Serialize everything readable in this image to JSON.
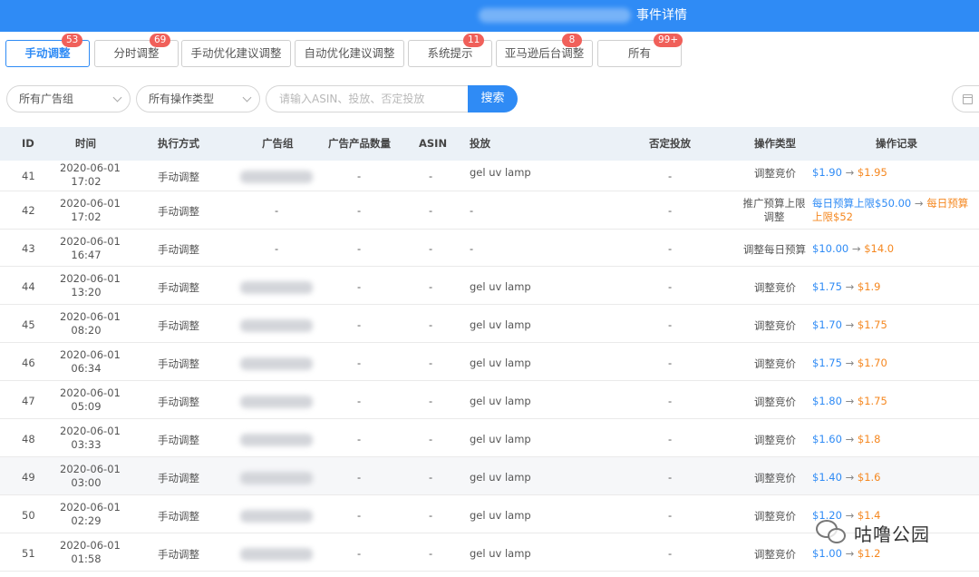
{
  "header": {
    "title": "事件详情"
  },
  "tabs": [
    {
      "label": "手动调整",
      "badge": "53"
    },
    {
      "label": "分时调整",
      "badge": "69"
    },
    {
      "label": "手动优化建议调整",
      "badge": ""
    },
    {
      "label": "自动优化建议调整",
      "badge": ""
    },
    {
      "label": "系统提示",
      "badge": "11"
    },
    {
      "label": "亚马逊后台调整",
      "badge": "8"
    },
    {
      "label": "所有",
      "badge": "99+"
    }
  ],
  "filters": {
    "ad_group_select": "所有广告组",
    "op_type_select": "所有操作类型",
    "search_placeholder": "请输入ASIN、投放、否定投放",
    "search_button": "搜索"
  },
  "columns": {
    "id": "ID",
    "time": "时间",
    "method": "执行方式",
    "ad_group": "广告组",
    "product_count": "广告产品数量",
    "asin": "ASIN",
    "targeting": "投放",
    "negative": "否定投放",
    "op_type": "操作类型",
    "op_record": "操作记录"
  },
  "rows": [
    {
      "id": "41",
      "date": "2020-06-01",
      "time": "17:02",
      "method": "手动调整",
      "ad_group": "",
      "product_count": "-",
      "asin": "-",
      "targeting": "gel uv lamp",
      "negative": "-",
      "op_type": "调整竞价",
      "from": "$1.90",
      "arrow": "→",
      "to": "$1.95"
    },
    {
      "id": "42",
      "date": "2020-06-01",
      "time": "17:02",
      "method": "手动调整",
      "ad_group": "-",
      "product_count": "-",
      "asin": "-",
      "targeting": "-",
      "negative": "-",
      "op_type": "推广预算上限调整",
      "from": "每日预算上限$50.00",
      "arrow": "→",
      "to": "每日预算上限$52"
    },
    {
      "id": "43",
      "date": "2020-06-01",
      "time": "16:47",
      "method": "手动调整",
      "ad_group": "-",
      "product_count": "-",
      "asin": "-",
      "targeting": "-",
      "negative": "-",
      "op_type": "调整每日预算",
      "from": "$10.00",
      "arrow": "→",
      "to": "$14.0"
    },
    {
      "id": "44",
      "date": "2020-06-01",
      "time": "13:20",
      "method": "手动调整",
      "ad_group": "",
      "product_count": "-",
      "asin": "-",
      "targeting": "gel uv lamp",
      "negative": "-",
      "op_type": "调整竞价",
      "from": "$1.75",
      "arrow": "→",
      "to": "$1.9"
    },
    {
      "id": "45",
      "date": "2020-06-01",
      "time": "08:20",
      "method": "手动调整",
      "ad_group": "",
      "product_count": "-",
      "asin": "-",
      "targeting": "gel uv lamp",
      "negative": "-",
      "op_type": "调整竞价",
      "from": "$1.70",
      "arrow": "→",
      "to": "$1.75"
    },
    {
      "id": "46",
      "date": "2020-06-01",
      "time": "06:34",
      "method": "手动调整",
      "ad_group": "",
      "product_count": "-",
      "asin": "-",
      "targeting": "gel uv lamp",
      "negative": "-",
      "op_type": "调整竞价",
      "from": "$1.75",
      "arrow": "→",
      "to": "$1.70"
    },
    {
      "id": "47",
      "date": "2020-06-01",
      "time": "05:09",
      "method": "手动调整",
      "ad_group": "",
      "product_count": "-",
      "asin": "-",
      "targeting": "gel uv lamp",
      "negative": "-",
      "op_type": "调整竞价",
      "from": "$1.80",
      "arrow": "→",
      "to": "$1.75"
    },
    {
      "id": "48",
      "date": "2020-06-01",
      "time": "03:33",
      "method": "手动调整",
      "ad_group": "",
      "product_count": "-",
      "asin": "-",
      "targeting": "gel uv lamp",
      "negative": "-",
      "op_type": "调整竞价",
      "from": "$1.60",
      "arrow": "→",
      "to": "$1.8"
    },
    {
      "id": "49",
      "date": "2020-06-01",
      "time": "03:00",
      "method": "手动调整",
      "ad_group": "",
      "product_count": "-",
      "asin": "-",
      "targeting": "gel uv lamp",
      "negative": "-",
      "op_type": "调整竞价",
      "from": "$1.40",
      "arrow": "→",
      "to": "$1.6"
    },
    {
      "id": "50",
      "date": "2020-06-01",
      "time": "02:29",
      "method": "手动调整",
      "ad_group": "",
      "product_count": "-",
      "asin": "-",
      "targeting": "gel uv lamp",
      "negative": "-",
      "op_type": "调整竞价",
      "from": "$1.20",
      "arrow": "→",
      "to": "$1.4"
    },
    {
      "id": "51",
      "date": "2020-06-01",
      "time": "01:58",
      "method": "手动调整",
      "ad_group": "",
      "product_count": "-",
      "asin": "-",
      "targeting": "gel uv lamp",
      "negative": "-",
      "op_type": "调整竞价",
      "from": "$1.00",
      "arrow": "→",
      "to": "$1.2"
    }
  ],
  "watermark": {
    "text": "咕噜公园"
  },
  "colors": {
    "accent": "#2f8bf5",
    "badge": "#f0605a",
    "new_value": "#f5871f",
    "header_bg": "#ebf1f7"
  },
  "icons": {
    "dropdown": "chevron-down-icon",
    "calendar": "calendar-icon",
    "watermark": "wechat-icon"
  }
}
